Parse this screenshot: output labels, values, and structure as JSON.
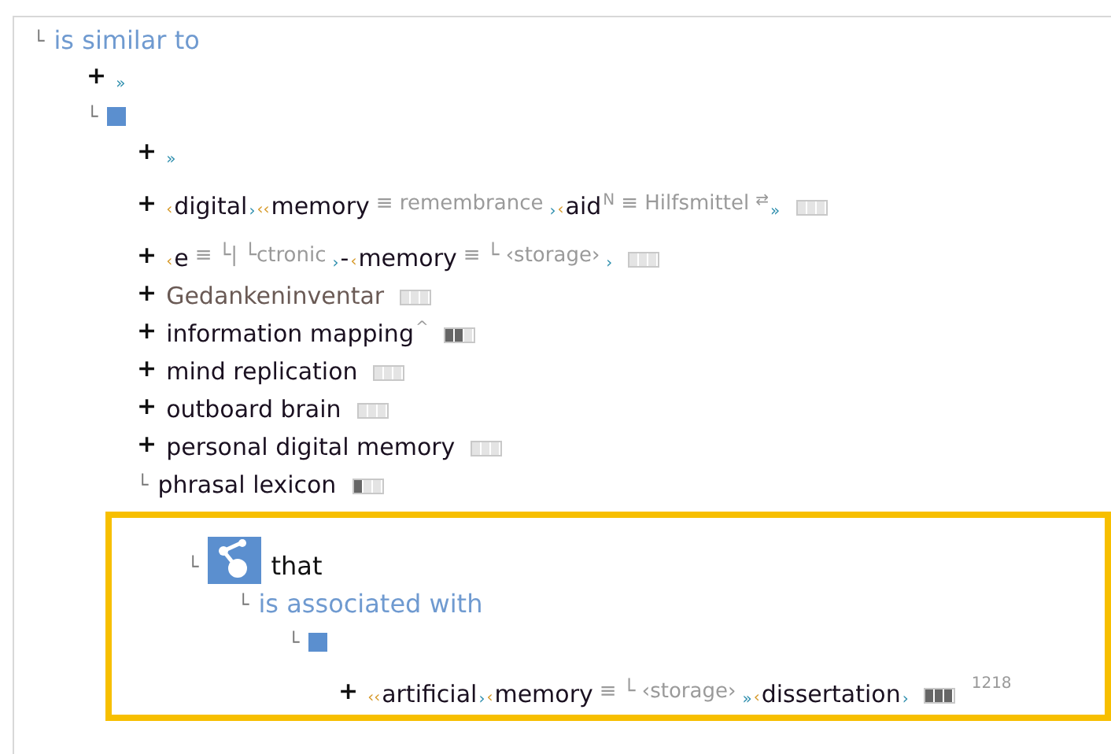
{
  "tree": [
    {
      "marker": "└",
      "expandable": false,
      "kind": "relation",
      "label": "is similar to",
      "children": [
        {
          "marker": "+",
          "expandable": true,
          "kind": "phrase",
          "parts": [
            {
              "kind": "close",
              "text": "»"
            }
          ]
        },
        {
          "marker": "└",
          "expandable": false,
          "kind": "square",
          "children": [
            {
              "marker": "+",
              "expandable": true,
              "kind": "phrase",
              "parts": [
                {
                  "kind": "close",
                  "text": "»"
                }
              ]
            },
            {
              "marker": "+",
              "expandable": true,
              "kind": "phrase",
              "parts": [
                {
                  "kind": "open",
                  "text": "‹"
                },
                {
                  "kind": "word",
                  "text": "digital"
                },
                {
                  "kind": "close",
                  "text": "›"
                },
                {
                  "kind": "open",
                  "text": "‹‹"
                },
                {
                  "kind": "word",
                  "text": "memory"
                },
                {
                  "kind": "gloss",
                  "text": "≡ remembrance"
                },
                {
                  "kind": "close",
                  "text": "›"
                },
                {
                  "kind": "open",
                  "text": "‹"
                },
                {
                  "kind": "word",
                  "text": "aid"
                },
                {
                  "kind": "sup",
                  "text": "N"
                },
                {
                  "kind": "gloss",
                  "text": "≡ Hilfsmittel"
                },
                {
                  "kind": "sup",
                  "text": "⇄"
                },
                {
                  "kind": "close",
                  "text": "»"
                }
              ],
              "meter": [
                {
                  "filled": false
                },
                {
                  "filled": false
                },
                {
                  "filled": false
                }
              ]
            },
            {
              "marker": "+",
              "expandable": true,
              "kind": "phrase",
              "parts": [
                {
                  "kind": "open",
                  "text": "‹"
                },
                {
                  "kind": "word",
                  "text": "e"
                },
                {
                  "kind": "gloss",
                  "text": "≡ └| └ctronic"
                },
                {
                  "kind": "close",
                  "text": "›"
                },
                {
                  "kind": "word",
                  "text": "-"
                },
                {
                  "kind": "open",
                  "text": "‹"
                },
                {
                  "kind": "word",
                  "text": "memory"
                },
                {
                  "kind": "gloss",
                  "text": "≡ └ ‹storage›"
                },
                {
                  "kind": "close",
                  "text": "›"
                }
              ],
              "meter": [
                {
                  "filled": false
                },
                {
                  "filled": false
                },
                {
                  "filled": false
                }
              ]
            },
            {
              "marker": "+",
              "expandable": true,
              "kind": "phrase",
              "parts": [
                {
                  "kind": "loan",
                  "text": "Gedankeninventar"
                }
              ],
              "meter": [
                {
                  "filled": false
                },
                {
                  "filled": false
                },
                {
                  "filled": false
                }
              ]
            },
            {
              "marker": "+",
              "expandable": true,
              "kind": "phrase",
              "parts": [
                {
                  "kind": "word",
                  "text": "information mapping"
                },
                {
                  "kind": "sup",
                  "text": "^"
                }
              ],
              "meter": [
                {
                  "filled": true
                },
                {
                  "filled": true
                },
                {
                  "filled": false
                }
              ]
            },
            {
              "marker": "+",
              "expandable": true,
              "kind": "phrase",
              "parts": [
                {
                  "kind": "word",
                  "text": "mind replication"
                }
              ],
              "meter": [
                {
                  "filled": false
                },
                {
                  "filled": false
                },
                {
                  "filled": false
                }
              ]
            },
            {
              "marker": "+",
              "expandable": true,
              "kind": "phrase",
              "parts": [
                {
                  "kind": "word",
                  "text": "outboard brain"
                }
              ],
              "meter": [
                {
                  "filled": false
                },
                {
                  "filled": false
                },
                {
                  "filled": false
                }
              ]
            },
            {
              "marker": "+",
              "expandable": true,
              "kind": "phrase",
              "parts": [
                {
                  "kind": "word",
                  "text": "personal digital memory"
                }
              ],
              "meter": [
                {
                  "filled": false
                },
                {
                  "filled": false
                },
                {
                  "filled": false
                }
              ]
            },
            {
              "marker": "└",
              "expandable": false,
              "kind": "phrase",
              "parts": [
                {
                  "kind": "word",
                  "text": "phrasal lexicon"
                }
              ],
              "meter": [
                {
                  "filled": true
                },
                {
                  "filled": false
                },
                {
                  "filled": false
                }
              ],
              "children": [
                {
                  "marker": "└",
                  "expandable": false,
                  "kind": "pattern",
                  "label": "that",
                  "highlighted": true,
                  "children": [
                    {
                      "marker": "└",
                      "expandable": false,
                      "kind": "relation",
                      "label": "is associated with",
                      "children": [
                        {
                          "marker": "└",
                          "expandable": false,
                          "kind": "square",
                          "children": [
                            {
                              "marker": "+",
                              "expandable": true,
                              "kind": "phrase",
                              "parts": [
                                {
                                  "kind": "open",
                                  "text": "‹‹"
                                },
                                {
                                  "kind": "word",
                                  "text": "artificial"
                                },
                                {
                                  "kind": "close",
                                  "text": "›"
                                },
                                {
                                  "kind": "open",
                                  "text": "‹"
                                },
                                {
                                  "kind": "word",
                                  "text": "memory"
                                },
                                {
                                  "kind": "gloss",
                                  "text": "≡ └ ‹storage›"
                                },
                                {
                                  "kind": "close",
                                  "text": "»"
                                },
                                {
                                  "kind": "open",
                                  "text": "‹"
                                },
                                {
                                  "kind": "word",
                                  "text": "dissertation"
                                },
                                {
                                  "kind": "close",
                                  "text": "›"
                                }
                              ],
                              "meter": [
                                {
                                  "filled": true
                                },
                                {
                                  "filled": true
                                },
                                {
                                  "filled": true
                                }
                              ],
                              "count": "1218"
                            }
                          ]
                        }
                      ]
                    }
                  ]
                }
              ]
            }
          ]
        }
      ]
    }
  ]
}
